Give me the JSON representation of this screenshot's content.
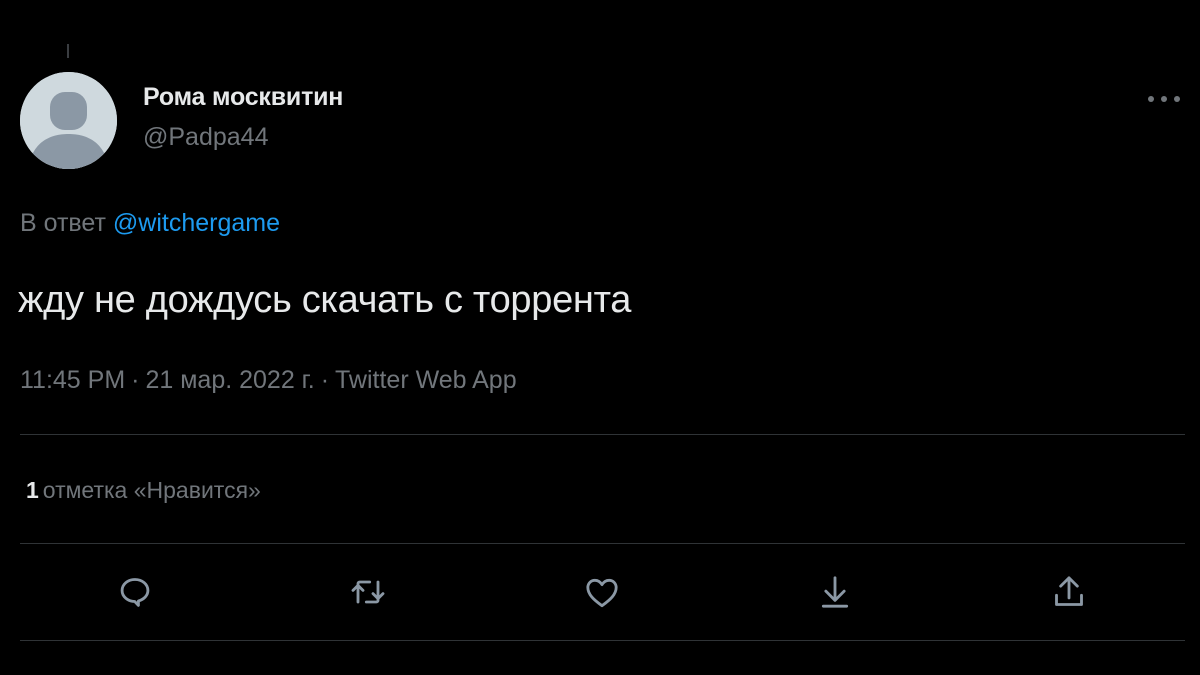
{
  "author": {
    "display_name": "Рома москвитин",
    "handle": "@Padpa44"
  },
  "reply_context": {
    "prefix": "В ответ",
    "mention": "@witchergame"
  },
  "tweet": {
    "text": "жду не дождусь скачать с торрента",
    "time": "11:45 PM",
    "separator": "·",
    "date": "21 мар. 2022 г.",
    "source": "Twitter Web App"
  },
  "stats": {
    "likes_count": "1",
    "likes_label": "отметка «Нравится»"
  },
  "actions": {
    "icons": [
      "reply-icon",
      "retweet-icon",
      "like-icon",
      "bookmark-icon",
      "share-icon"
    ]
  },
  "colors": {
    "background": "#000000",
    "text_primary": "#e7e9ea",
    "text_secondary": "#71767b",
    "link": "#1d9bf0",
    "divider": "#2f3336",
    "avatar_bg": "#cfd9de",
    "avatar_figure": "#8b98a5"
  }
}
